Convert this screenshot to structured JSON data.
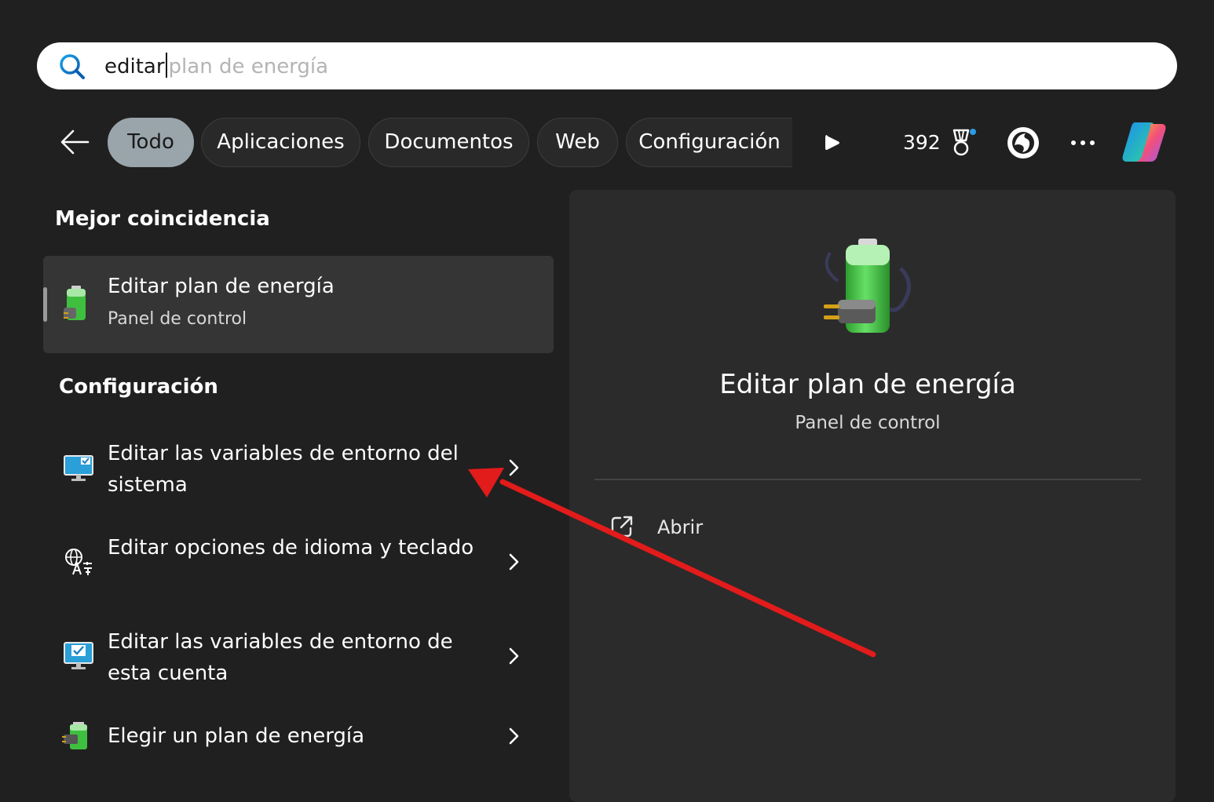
{
  "search": {
    "typed": "editar",
    "suggestion": "plan de energía"
  },
  "filters": {
    "tabs": [
      {
        "label": "Todo",
        "active": true
      },
      {
        "label": "Aplicaciones",
        "active": false
      },
      {
        "label": "Documentos",
        "active": false
      },
      {
        "label": "Web",
        "active": false
      },
      {
        "label": "Configuración",
        "active": false
      }
    ],
    "points": "392"
  },
  "best_match": {
    "heading": "Mejor coincidencia",
    "title": "Editar plan de energía",
    "subtitle": "Panel de control",
    "icon": "battery-plug-icon"
  },
  "settings": {
    "heading": "Configuración",
    "items": [
      {
        "label": "Editar las variables de entorno del sistema",
        "icon": "monitor-check-icon"
      },
      {
        "label": "Editar opciones de idioma y teclado",
        "icon": "language-icon"
      },
      {
        "label": "Editar las variables de entorno de esta cuenta",
        "icon": "monitor-check-icon"
      },
      {
        "label": "Elegir un plan de energía",
        "icon": "battery-plug-icon"
      }
    ]
  },
  "preview": {
    "title": "Editar plan de energía",
    "subtitle": "Panel de control",
    "action_open": "Abrir"
  },
  "colors": {
    "background": "#202020",
    "panel": "#2b2b2b",
    "active_pill": "#9aa5ab",
    "annotation": "#e21b1b",
    "search_accent": "#0a7fc8"
  }
}
